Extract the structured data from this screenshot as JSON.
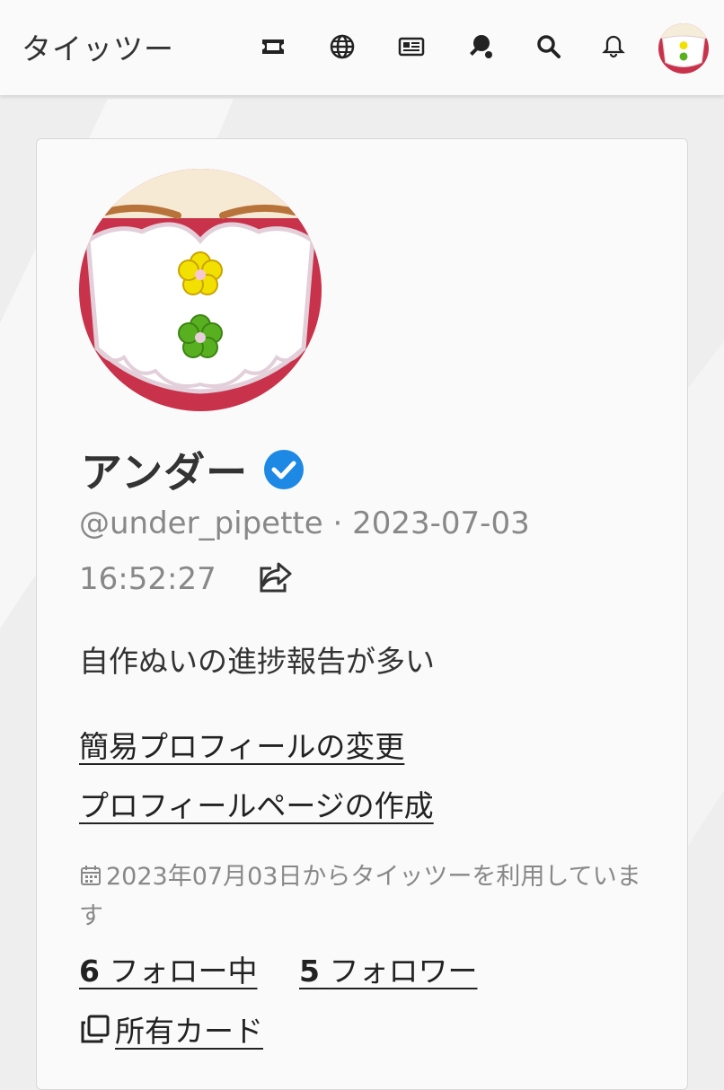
{
  "header": {
    "app_title": "タイッツー",
    "icons": [
      "ticket-icon",
      "globe-icon",
      "newspaper-icon",
      "ping-pong-icon",
      "search-icon",
      "bell-icon"
    ]
  },
  "profile": {
    "display_name": "アンダー",
    "username": "@under_pipette",
    "separator": "·",
    "date": "2023-07-03",
    "time": "16:52:27",
    "bio": "自作ぬいの進捗報告が多い",
    "links": [
      "簡易プロフィールの変更",
      "プロフィールページの作成"
    ],
    "joined": "2023年07月03日からタイッツーを利用しています",
    "following_count": "6",
    "following_label": "フォロー中",
    "followers_count": "5",
    "followers_label": "フォロワー",
    "cards_label": "所有カード"
  },
  "colors": {
    "verified": "#1e88e5",
    "avatar_red": "#c8324a",
    "flower_yellow": "#f2e000",
    "flower_green": "#58b020"
  }
}
